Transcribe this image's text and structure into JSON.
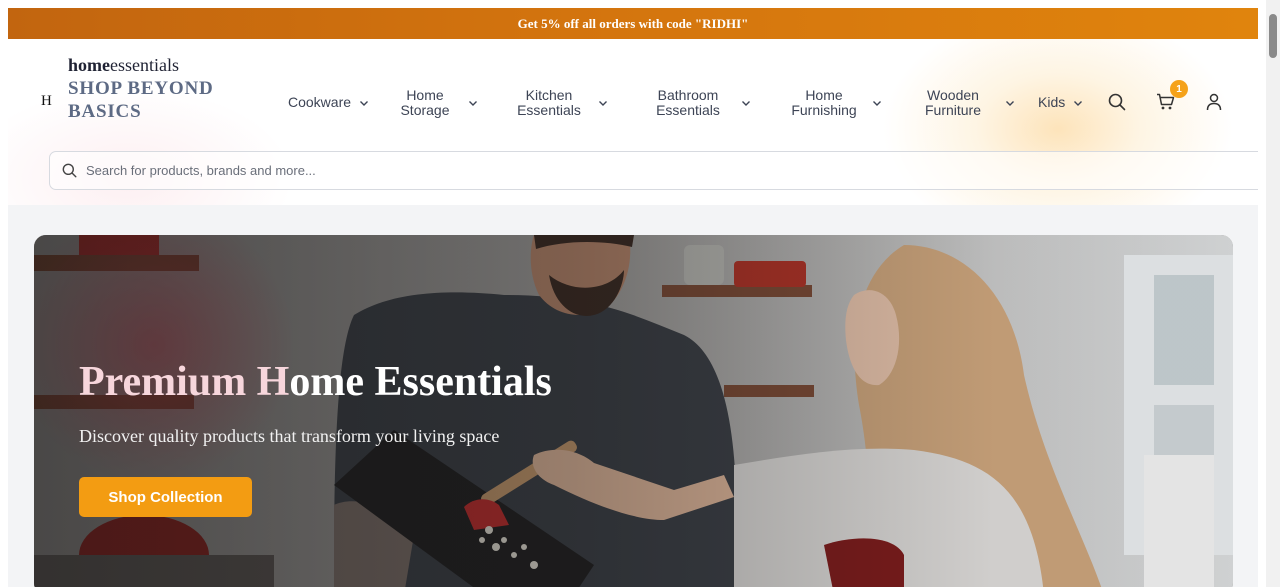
{
  "promo": {
    "text": "Get 5% off all orders with code \"RIDHI\""
  },
  "brand": {
    "mark": "H",
    "name_bold": "home",
    "name_regular": "essentials",
    "tagline": "SHOP BEYOND BASICS"
  },
  "nav": {
    "items": [
      {
        "label": "Cookware"
      },
      {
        "label": "Home Storage"
      },
      {
        "label": "Kitchen Essentials"
      },
      {
        "label": "Bathroom Essentials"
      },
      {
        "label": "Home Furnishing"
      },
      {
        "label": "Wooden Furniture"
      },
      {
        "label": "Kids"
      }
    ],
    "cart_count": "1",
    "icons": [
      "search-icon",
      "cart-icon",
      "user-icon",
      "chevron-down-icon"
    ]
  },
  "search": {
    "placeholder": "Search for products, brands and more..."
  },
  "hero": {
    "title_part1": "Premium H",
    "title_part2": "ome Essentials",
    "subtitle": "Discover quality products that transform your living space",
    "cta_label": "Shop Collection"
  },
  "colors": {
    "promo_start": "#c2650f",
    "promo_end": "#e0840d",
    "accent": "#f39c12",
    "badge": "#f5a21a",
    "tagline": "#5d6a84"
  }
}
